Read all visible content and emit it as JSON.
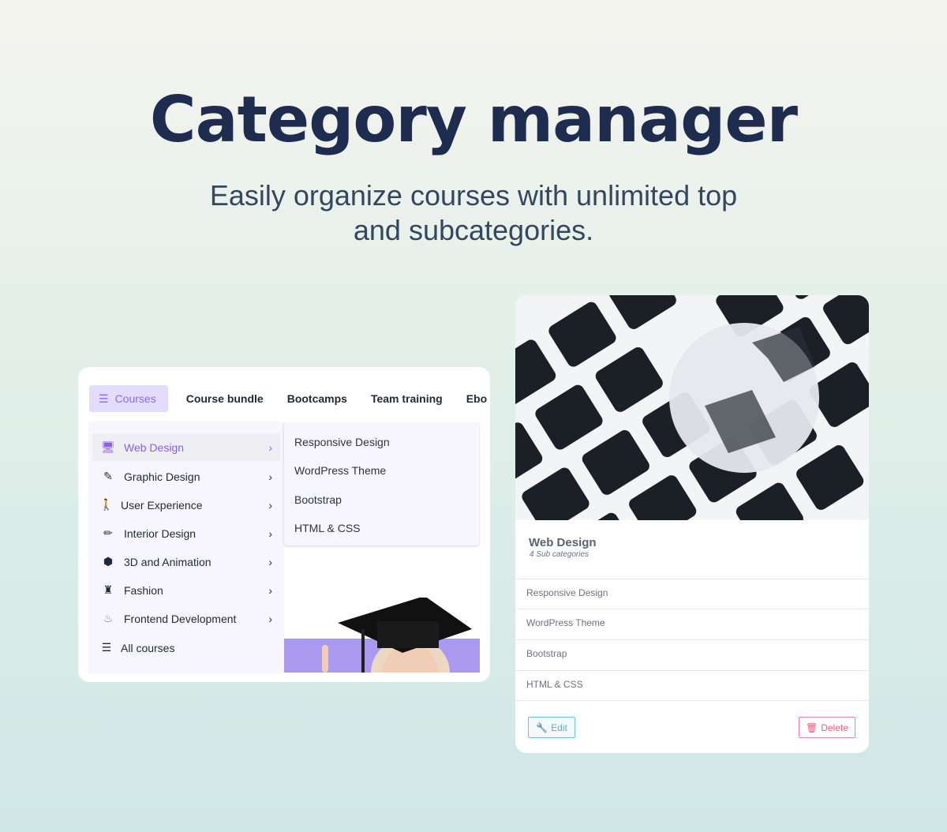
{
  "header": {
    "title": "Category manager",
    "subtitle_line1": "Easily organize courses with unlimited top",
    "subtitle_line2": "and subcategories."
  },
  "menu_demo": {
    "nav": {
      "courses": "Courses",
      "items": [
        "Course bundle",
        "Bootcamps",
        "Team training",
        "Ebo"
      ]
    },
    "categories": [
      {
        "label": "Web Design",
        "icon": "monitor-icon",
        "active": true
      },
      {
        "label": "Graphic Design",
        "icon": "pencil-icon"
      },
      {
        "label": "User Experience",
        "icon": "person-icon"
      },
      {
        "label": "Interior Design",
        "icon": "pen-icon"
      },
      {
        "label": "3D and Animation",
        "icon": "cube-icon"
      },
      {
        "label": "Fashion",
        "icon": "fashion-icon"
      },
      {
        "label": "Frontend Development",
        "icon": "code-icon"
      }
    ],
    "all_courses": "All courses",
    "subcategories": [
      "Responsive Design",
      "WordPress Theme",
      "Bootstrap",
      "HTML & CSS"
    ],
    "accent": "#8b5cf6"
  },
  "category_card": {
    "title": "Web Design",
    "subtitle": "4 Sub categories",
    "subcategories": [
      "Responsive Design",
      "WordPress Theme",
      "Bootstrap",
      "HTML & CSS"
    ],
    "edit_label": "Edit",
    "delete_label": "Delete"
  }
}
